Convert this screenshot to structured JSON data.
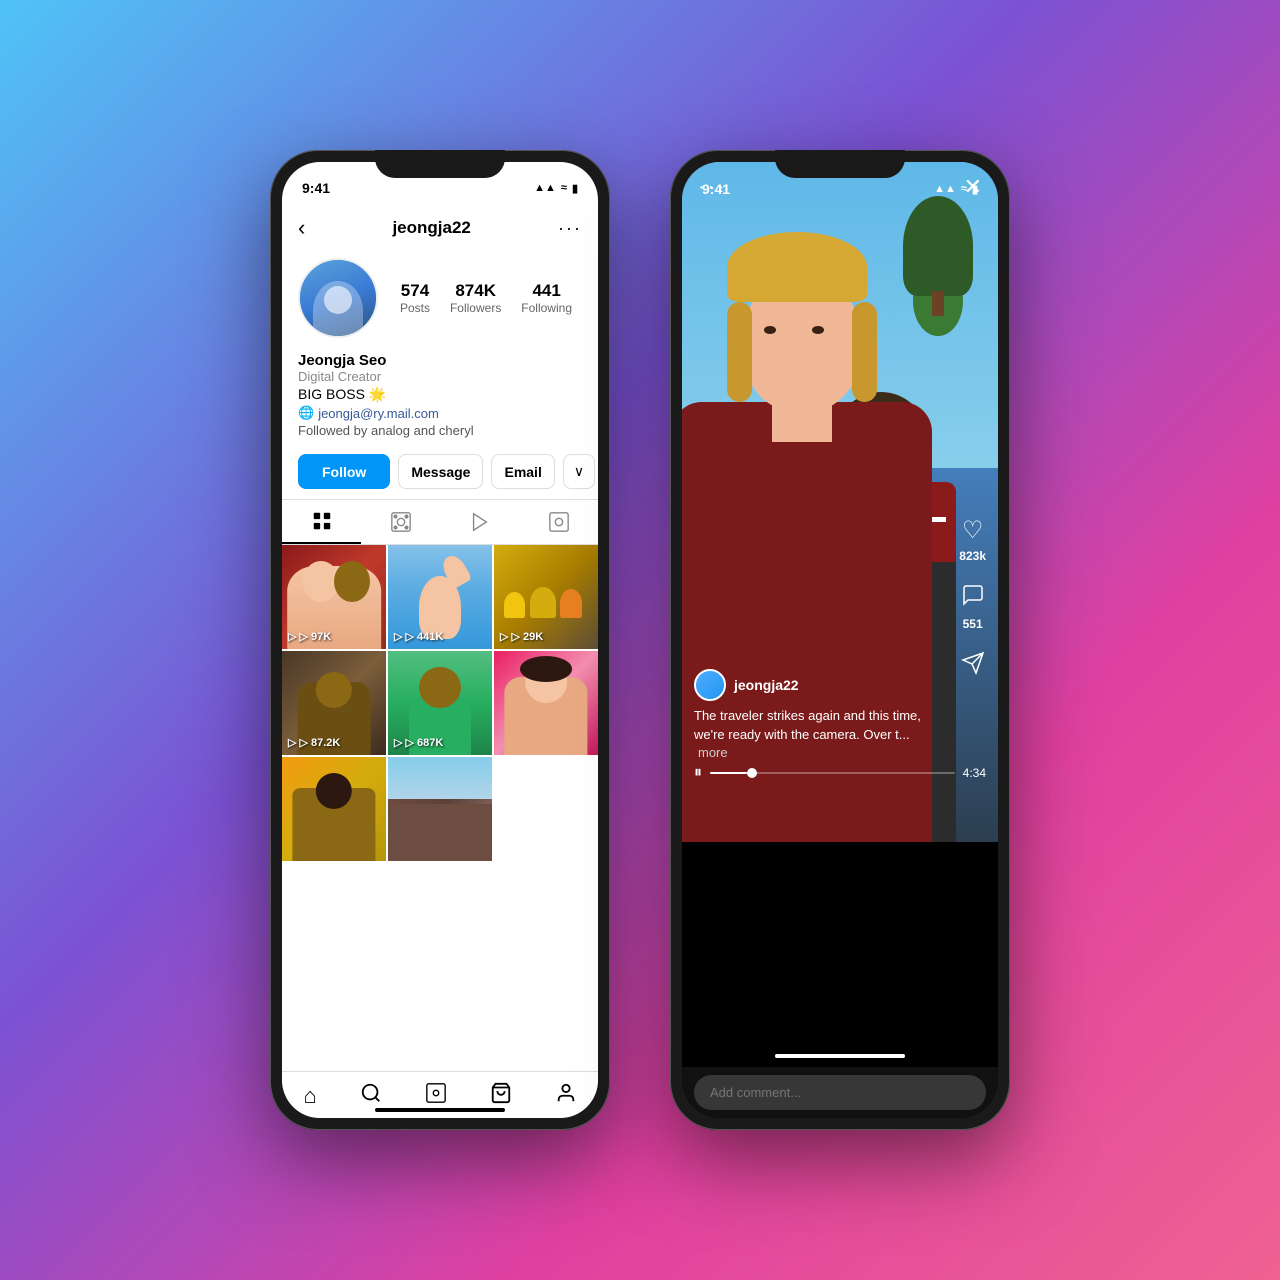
{
  "background": {
    "gradient": "linear-gradient(135deg, #4fc3f7 0%, #7b52d3 40%, #e040a0 70%, #f06292 100%)"
  },
  "phone1": {
    "statusBar": {
      "time": "9:41",
      "signal": "▲▲▲",
      "wifi": "wifi",
      "battery": "battery"
    },
    "header": {
      "back": "‹",
      "username": "jeongja22",
      "more": "···"
    },
    "stats": {
      "posts": {
        "value": "574",
        "label": "Posts"
      },
      "followers": {
        "value": "874K",
        "label": "Followers"
      },
      "following": {
        "value": "441",
        "label": "Following"
      }
    },
    "profileInfo": {
      "name": "Jeongja Seo",
      "role": "Digital Creator",
      "bio": "BIG BOSS 🌟",
      "email": "jeongja@ry.mail.com",
      "followedBy": "Followed by analog and cheryl"
    },
    "actions": {
      "follow": "Follow",
      "message": "Message",
      "email": "Email",
      "dropdown": "∨"
    },
    "tabs": {
      "grid": "⊞",
      "reels": "▷",
      "video": "🎬",
      "tag": "👤"
    },
    "photos": [
      {
        "views": "▷ 97K",
        "color": "#c0392b"
      },
      {
        "views": "▷ 441K",
        "color": "#3498db"
      },
      {
        "views": "▷ 29K",
        "color": "#d4ac0d"
      },
      {
        "views": "▷ 87.2K",
        "color": "#7b5e3a"
      },
      {
        "views": "▷ 687K",
        "color": "#2ecc71"
      },
      {
        "views": "",
        "color": "#e91e63"
      },
      {
        "views": "",
        "color": "#f1c40f"
      },
      {
        "views": "",
        "color": "#795548"
      }
    ],
    "bottomNav": {
      "home": "⌂",
      "search": "🔍",
      "reels": "▷",
      "shop": "🛍",
      "profile": "👤"
    }
  },
  "phone2": {
    "statusBar": {
      "time": "9:41",
      "signal": "▲▲▲",
      "wifi": "wifi",
      "battery": "battery"
    },
    "videoControls": {
      "more": "···",
      "close": "✕"
    },
    "actions": {
      "like": {
        "icon": "♡",
        "count": "823k"
      },
      "comment": {
        "icon": "○",
        "count": "551"
      },
      "share": {
        "icon": "▷",
        "count": ""
      }
    },
    "userInfo": {
      "username": "jeongja22",
      "caption": "The traveler strikes again and this time, we're ready with the camera. Over t...",
      "more": "more"
    },
    "progress": {
      "playIcon": "⏸",
      "currentTime": "",
      "duration": "4:34",
      "percent": 15
    },
    "comment": {
      "placeholder": "Add comment..."
    }
  }
}
